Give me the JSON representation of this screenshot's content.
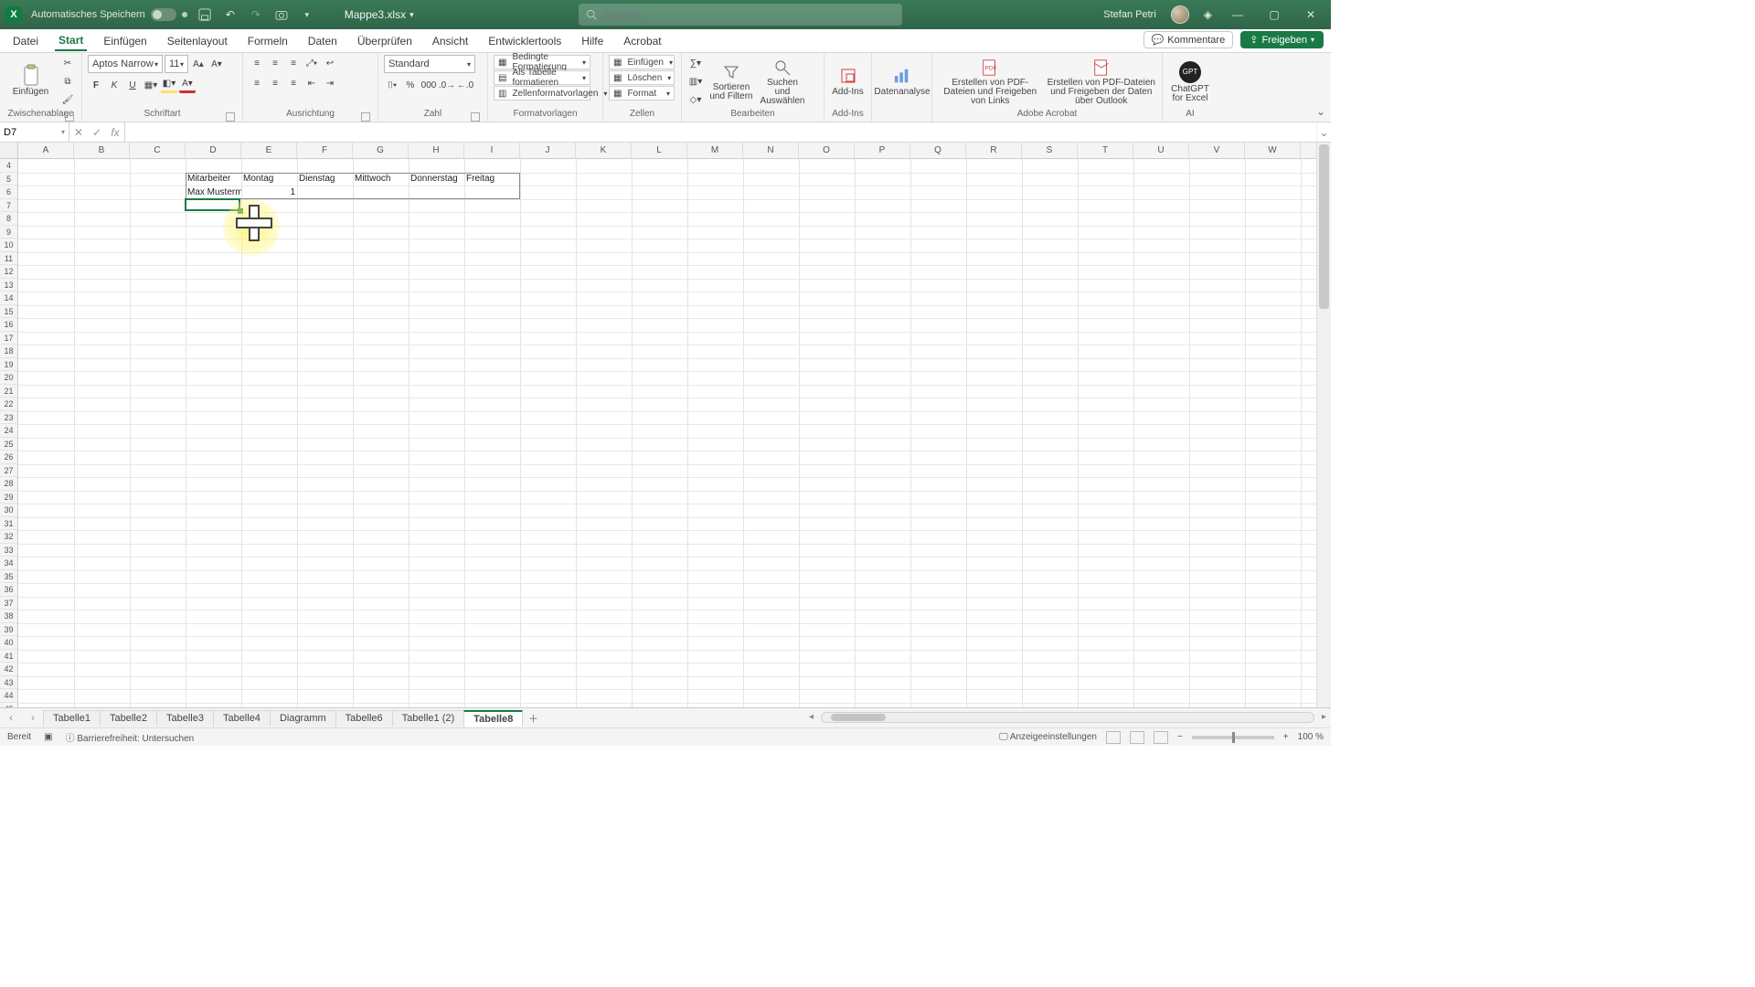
{
  "title": {
    "autosave_label": "Automatisches Speichern",
    "filename": "Mappe3.xlsx",
    "user": "Stefan Petri"
  },
  "search": {
    "placeholder": "Suchen"
  },
  "tabs": {
    "items": [
      "Datei",
      "Start",
      "Einfügen",
      "Seitenlayout",
      "Formeln",
      "Daten",
      "Überprüfen",
      "Ansicht",
      "Entwicklertools",
      "Hilfe",
      "Acrobat"
    ],
    "active": 1,
    "comments": "Kommentare",
    "share": "Freigeben"
  },
  "ribbon": {
    "clipboard": {
      "paste": "Einfügen",
      "caption": "Zwischenablage"
    },
    "font": {
      "name": "Aptos Narrow",
      "size": "11",
      "caption": "Schriftart"
    },
    "align": {
      "caption": "Ausrichtung"
    },
    "number": {
      "format": "Standard",
      "caption": "Zahl"
    },
    "styles": {
      "cond": "Bedingte Formatierung",
      "table": "Als Tabelle formatieren",
      "cell": "Zellenformatvorlagen",
      "caption": "Formatvorlagen"
    },
    "cells": {
      "insert": "Einfügen",
      "delete": "Löschen",
      "format": "Format",
      "caption": "Zellen"
    },
    "editing": {
      "sort": "Sortieren und Filtern",
      "find": "Suchen und Auswählen",
      "caption": "Bearbeiten"
    },
    "addins": {
      "addins": "Add-Ins",
      "caption": "Add-Ins"
    },
    "analysis": {
      "label": "Datenanalyse"
    },
    "acrobat": {
      "pdf_links": "Erstellen von PDF-Dateien und Freigeben von Links",
      "pdf_outlook": "Erstellen von PDF-Dateien und Freigeben der Daten über Outlook",
      "caption": "Adobe Acrobat"
    },
    "ai": {
      "gpt": "ChatGPT for Excel",
      "caption": "AI"
    }
  },
  "namebox": "D7",
  "formula": "",
  "grid": {
    "columns": [
      "A",
      "B",
      "C",
      "D",
      "E",
      "F",
      "G",
      "H",
      "I",
      "J",
      "K",
      "L",
      "M",
      "N",
      "O",
      "P",
      "Q",
      "R",
      "S",
      "T",
      "U",
      "V",
      "W"
    ],
    "first_row": 4,
    "last_row": 45,
    "headers": [
      "Mitarbeiter",
      "Montag",
      "Dienstag",
      "Mittwoch",
      "Donnerstag",
      "Freitag"
    ],
    "row_data": {
      "mitarbeiter": "Max Musterm",
      "montag": "1"
    }
  },
  "sheets": {
    "items": [
      "Tabelle1",
      "Tabelle2",
      "Tabelle3",
      "Tabelle4",
      "Diagramm",
      "Tabelle6",
      "Tabelle1 (2)",
      "Tabelle8"
    ],
    "active": 7
  },
  "status": {
    "ready": "Bereit",
    "access": "Barrierefreiheit: Untersuchen",
    "display": "Anzeigeeinstellungen",
    "zoom": "100 %"
  }
}
